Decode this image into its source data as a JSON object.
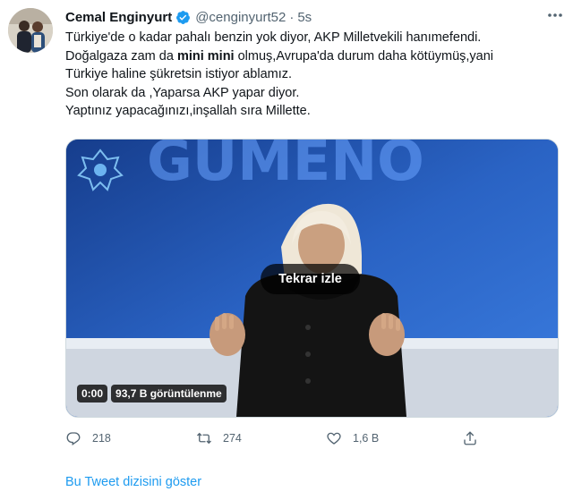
{
  "tweet": {
    "author_name": "Cemal Enginyurt",
    "author_handle": "@cenginyurt52",
    "separator": "·",
    "time": "5s",
    "lines": [
      "Türkiye'de o kadar pahalı benzin yok diyor, AKP Milletvekili hanımefendi.",
      "Doğalgaza zam da ",
      "mini mini",
      " olmuş,Avrupa'da durum daha kötüymüş,yani",
      "Türkiye haline şükretsin istiyor ablamız.",
      "Son olarak da ,Yaparsa AKP yapar diyor.",
      "Yaptınız yapacağınızı,inşallah sıra Millette."
    ]
  },
  "video": {
    "replay_label": "Tekrar izle",
    "time": "0:00",
    "views": "93,7 B görüntülenme",
    "background_word": "GÜMENO"
  },
  "actions": {
    "reply_count": "218",
    "retweet_count": "274",
    "like_count": "1,6 B",
    "share_icon": "share-icon"
  },
  "thread_link": "Bu Tweet dizisini göster",
  "colors": {
    "link": "#1d9bf0",
    "verified": "#1d9bf0",
    "secondary": "#536471"
  }
}
